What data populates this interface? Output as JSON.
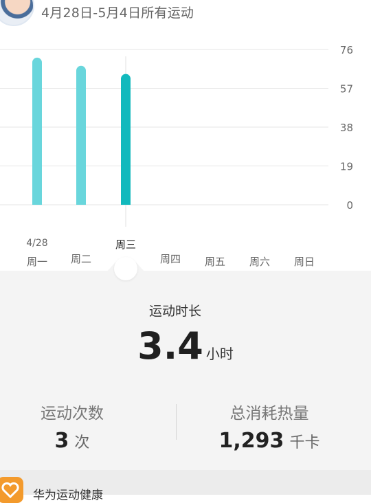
{
  "header": {
    "title": "4月28日-5月4日所有运动"
  },
  "chart_data": {
    "type": "bar",
    "categories": [
      "周一",
      "周二",
      "周三",
      "周四",
      "周五",
      "周六",
      "周日"
    ],
    "date_label": "4/28",
    "values": [
      72,
      68,
      64,
      0,
      0,
      0,
      0
    ],
    "selected_index": 2,
    "y_ticks": [
      "76",
      "57",
      "38",
      "19",
      "0"
    ],
    "ylim": [
      0,
      76
    ],
    "colors": {
      "bar": "#69d6dc",
      "selected": "#12b9bd",
      "grid": "#e6e6e6"
    }
  },
  "summary": {
    "duration_label": "运动时长",
    "duration_value": "3.4",
    "duration_unit": "小时",
    "count_label": "运动次数",
    "count_value": "3",
    "count_unit": "次",
    "calories_label": "总消耗热量",
    "calories_value": "1,293",
    "calories_unit": "千卡"
  },
  "banner": {
    "app_name": "华为运动健康",
    "icon": "huawei-health-icon"
  }
}
